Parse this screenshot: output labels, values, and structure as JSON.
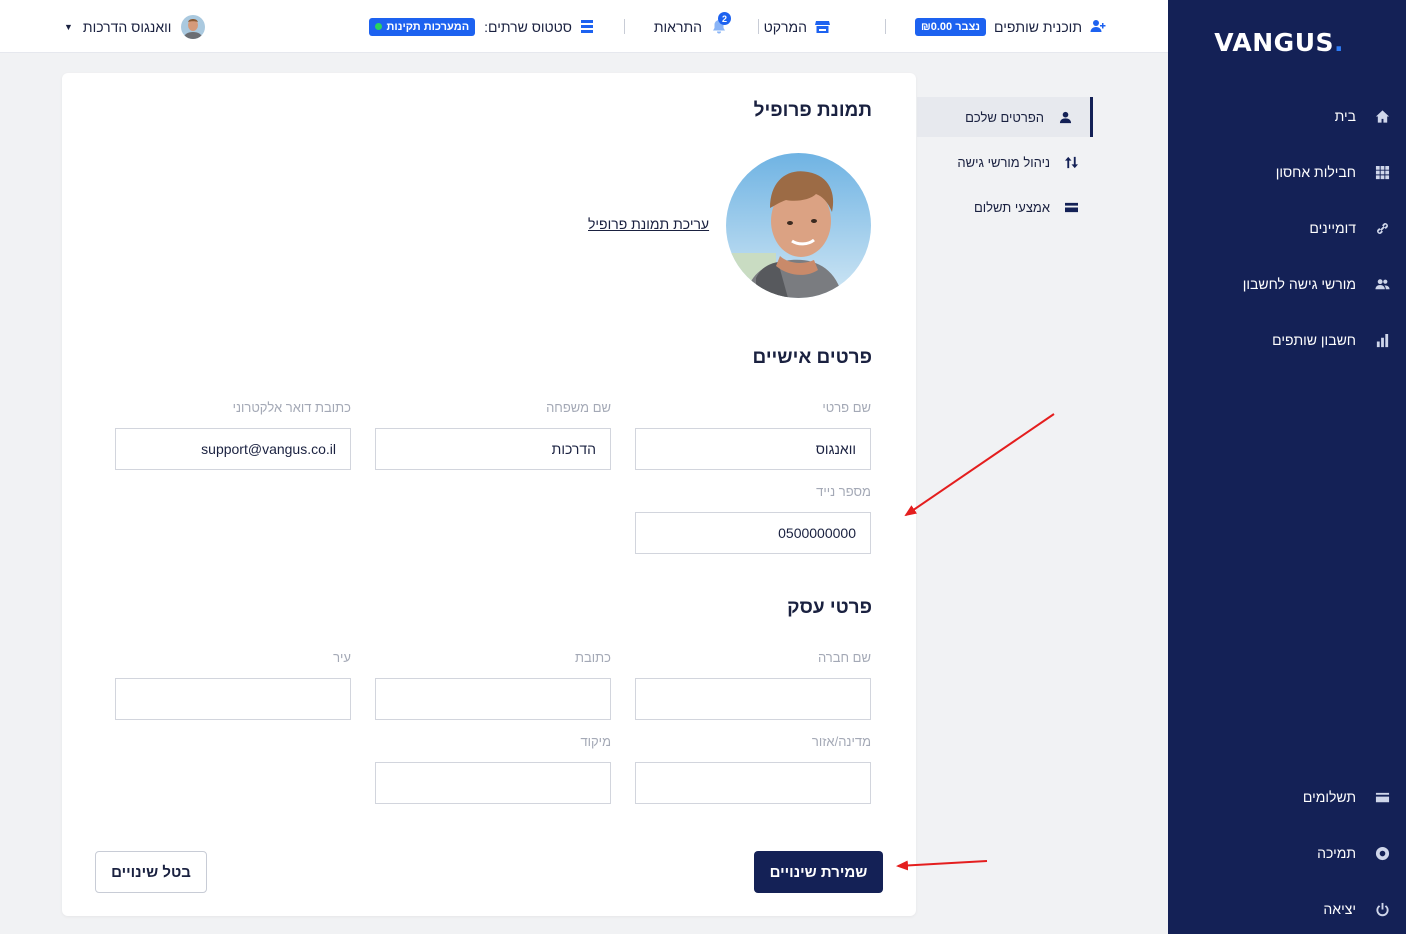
{
  "brand": {
    "logo_text": "VANGUS",
    "logo_dot": "."
  },
  "sidebar": {
    "items": [
      {
        "label": "בית",
        "icon": "home-icon"
      },
      {
        "label": "חבילות אחסון",
        "icon": "grid-icon"
      },
      {
        "label": "דומיינים",
        "icon": "link-icon"
      },
      {
        "label": "מורשי גישה לחשבון",
        "icon": "users-icon"
      },
      {
        "label": "חשבון שותפים",
        "icon": "bar-chart-icon"
      },
      {
        "label": "תשלומים",
        "icon": "credit-card-icon"
      },
      {
        "label": "תמיכה",
        "icon": "lifebuoy-icon"
      },
      {
        "label": "יציאה",
        "icon": "power-icon"
      }
    ]
  },
  "topbar": {
    "affiliate_label": "תוכנית שותפים",
    "affiliate_badge": "נצבר ₪0.00",
    "market_label": "המרקט",
    "notifications_label": "התראות",
    "notifications_count": "2",
    "server_status_label": "סטטוס שרתים:",
    "server_status_badge": "המערכות תקינות",
    "user_name": "וואנגוס הדרכות"
  },
  "subnav": {
    "items": [
      {
        "label": "הפרטים שלכם",
        "icon": "user-icon",
        "active": true
      },
      {
        "label": "ניהול מורשי גישה",
        "icon": "sort-arrows-icon",
        "active": false
      },
      {
        "label": "אמצעי תשלום",
        "icon": "credit-card-icon",
        "active": false
      }
    ]
  },
  "profile": {
    "picture_heading": "תמונת פרופיל",
    "edit_picture_link": "עריכת תמונת פרופיל",
    "personal_heading": "פרטים אישיים",
    "first_name_label": "שם פרטי",
    "first_name_value": "וואנגוס",
    "last_name_label": "שם משפחה",
    "last_name_value": "הדרכות",
    "email_label": "כתובת דואר אלקטרוני",
    "email_value": "support@vangus.co.il",
    "mobile_label": "מספר נייד",
    "mobile_value": "0500000000",
    "business_heading": "פרטי עסק",
    "company_label": "שם חברה",
    "company_value": "",
    "address_label": "כתובת",
    "address_value": "",
    "city_label": "עיר",
    "city_value": "",
    "region_label": "מדינה/אזור",
    "region_value": "",
    "zip_label": "מיקוד",
    "zip_value": "",
    "save_button": "שמירת שינויים",
    "cancel_button": "בטל שינויים"
  },
  "colors": {
    "sidebar_bg": "#142156",
    "accent_blue": "#1d62f0",
    "status_green": "#2ad45c",
    "annotation_red": "#e41e1e"
  }
}
